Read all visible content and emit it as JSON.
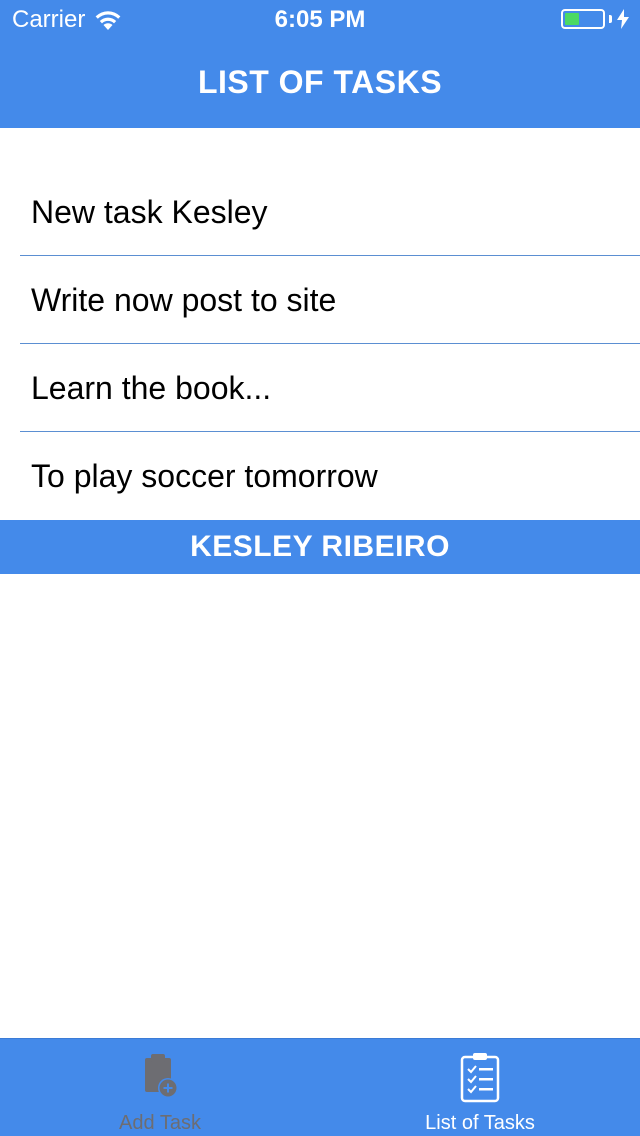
{
  "status_bar": {
    "carrier": "Carrier",
    "time": "6:05 PM"
  },
  "nav": {
    "title": "LIST OF TASKS"
  },
  "tasks": [
    {
      "title": "New task Kesley"
    },
    {
      "title": "Write now post to site"
    },
    {
      "title": "Learn the book..."
    },
    {
      "title": "To play soccer tomorrow"
    }
  ],
  "footer": {
    "name": "KESLEY RIBEIRO"
  },
  "tabs": [
    {
      "label": "Add Task",
      "icon": "clipboard-add-icon",
      "active": false
    },
    {
      "label": "List of Tasks",
      "icon": "checklist-icon",
      "active": true
    }
  ],
  "colors": {
    "accent": "#448aea",
    "separator": "#5b8fd2",
    "battery": "#4cd964",
    "inactive_tab": "#6d6d72"
  }
}
